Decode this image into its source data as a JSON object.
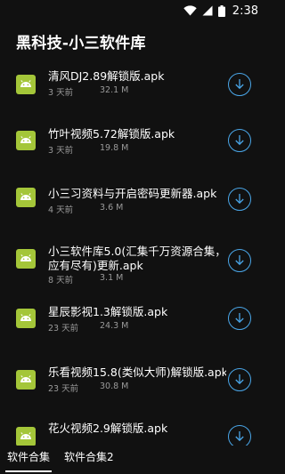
{
  "status_bar": {
    "time": "2:38",
    "icons": [
      "wifi-icon",
      "signal-icon",
      "battery-icon"
    ]
  },
  "app_bar": {
    "title": "黑科技-小三软件库"
  },
  "files": [
    {
      "name": "清风DJ2.89解锁版.apk",
      "age": "3 天前",
      "size": "32.1 M"
    },
    {
      "name": "竹叶视频5.72解锁版.apk",
      "age": "3 天前",
      "size": "19.8 M"
    },
    {
      "name": "小三习资料与开启密码更新器.apk",
      "age": "4 天前",
      "size": "3.6 M"
    },
    {
      "name": "小三软件库5.0(汇集千万资源合集，应有尽有)更新.apk",
      "age": "8 天前",
      "size": "3.1 M"
    },
    {
      "name": "星辰影视1.3解锁版.apk",
      "age": "23 天前",
      "size": "24.3 M"
    },
    {
      "name": "乐看视频15.8(类似大师)解锁版.apk",
      "age": "23 天前",
      "size": "30.8 M"
    },
    {
      "name": "花火视频2.9解锁版.apk",
      "age": "",
      "size": ""
    }
  ],
  "tabs": [
    {
      "label": "软件合集",
      "active": true
    },
    {
      "label": "软件合集2",
      "active": false
    }
  ],
  "colors": {
    "background": "#111111",
    "icon_green": "#a4c639",
    "download_blue": "#4aa6e8",
    "meta_gray": "#9a9a9a"
  }
}
